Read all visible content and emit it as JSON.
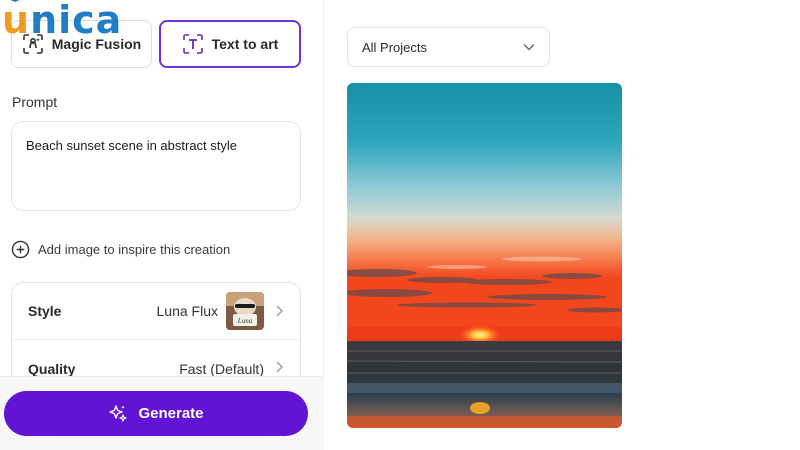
{
  "brand": {
    "logo_first": "u",
    "logo_rest": "nica"
  },
  "tabs": [
    {
      "label": "Magic Fusion",
      "icon": "face-scan-icon",
      "active": false
    },
    {
      "label": "Text to art",
      "icon": "text-frame-icon",
      "active": true
    }
  ],
  "prompt": {
    "label": "Prompt",
    "value": "Beach sunset scene in abstract style"
  },
  "add_image": {
    "label": "Add image to inspire this creation",
    "icon": "plus-circle-icon"
  },
  "settings": {
    "style": {
      "label": "Style",
      "value": "Luna Flux",
      "thumb_text": "Luna"
    },
    "quality": {
      "label": "Quality",
      "value": "Fast (Default)"
    }
  },
  "generate": {
    "label": "Generate",
    "icon": "sparkle-icon"
  },
  "projects_filter": {
    "value": "All Projects",
    "icon": "chevron-down-icon"
  },
  "colors": {
    "accent": "#6214d4",
    "tab_border": "#6b34d9",
    "logo_orange": "#f29b22",
    "logo_blue": "#1f7ec6"
  }
}
